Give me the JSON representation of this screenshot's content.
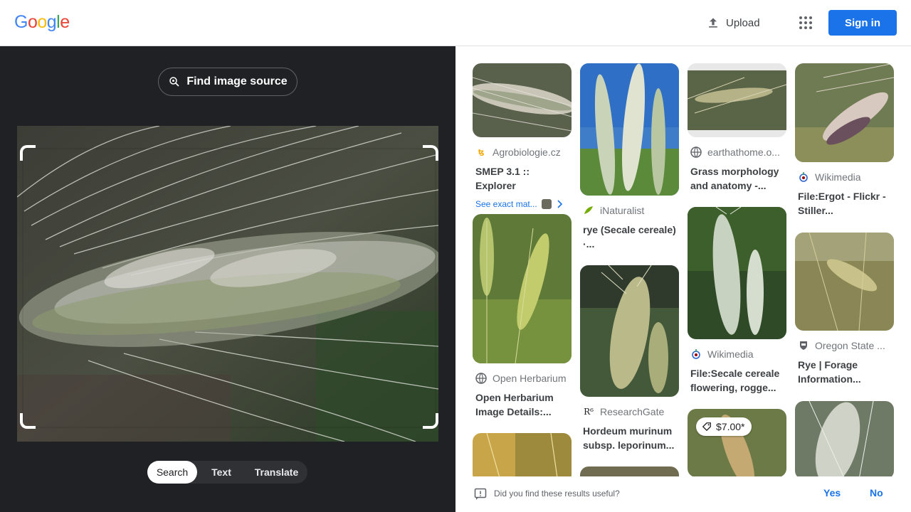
{
  "header": {
    "logo_letters": [
      "G",
      "o",
      "o",
      "g",
      "l",
      "e"
    ],
    "logo_colors": [
      "#4285f4",
      "#ea4335",
      "#fbbc05",
      "#4285f4",
      "#34a853",
      "#ea4335"
    ],
    "upload_label": "Upload",
    "signin_label": "Sign in"
  },
  "lens": {
    "find_source_label": "Find image source",
    "modes": [
      "Search",
      "Text",
      "Translate"
    ],
    "active_mode": "Search"
  },
  "results": [
    {
      "source": "Agrobiologie.cz",
      "title": "SMEP 3.1 :: Explorer",
      "exact_match": "See exact mat..."
    },
    {
      "source": "iNaturalist",
      "title": "rye (Secale cereale) ·..."
    },
    {
      "source": "earthathome.o...",
      "title": "Grass morphology and anatomy -..."
    },
    {
      "source": "Wikimedia",
      "title": "File:Ergot - Flickr - Stiller..."
    },
    {
      "source": "Open Herbarium",
      "title": "Open Herbarium Image Details:..."
    },
    {
      "source": "ResearchGate",
      "title": "Hordeum murinum subsp. leporinum..."
    },
    {
      "source": "Wikimedia",
      "title": "File:Secale cereale flowering, rogge..."
    },
    {
      "source": "Oregon State ...",
      "title": "Rye | Forage Information..."
    }
  ],
  "price_badge": "$7.00*",
  "feedback": {
    "question": "Did you find these results useful?",
    "yes": "Yes",
    "no": "No"
  },
  "colors": {
    "accent": "#1a73e8",
    "dark_panel": "#202124"
  }
}
